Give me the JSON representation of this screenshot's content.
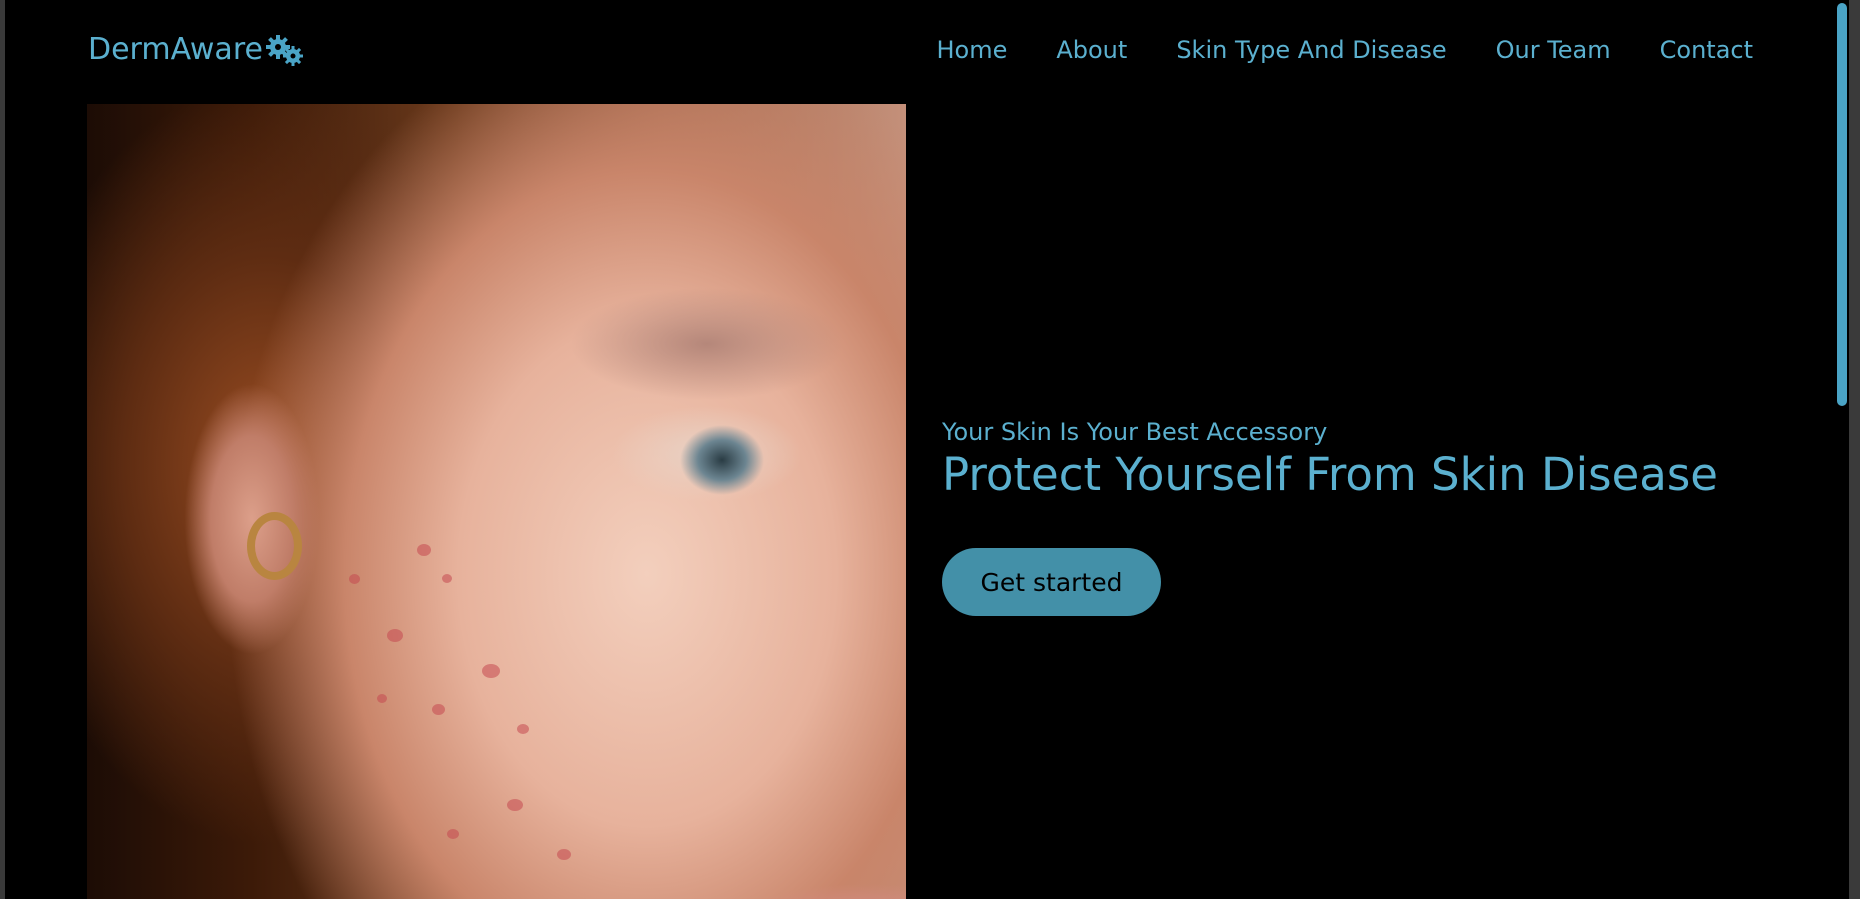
{
  "brand": {
    "name": "DermAware",
    "icon": "gears-icon",
    "color": "#5bb0cf"
  },
  "nav": {
    "items": [
      {
        "label": "Home"
      },
      {
        "label": "About"
      },
      {
        "label": "Skin Type And Disease"
      },
      {
        "label": "Our Team"
      },
      {
        "label": "Contact"
      }
    ]
  },
  "hero": {
    "tagline": "Your Skin Is Your Best Accessory",
    "headline": "Protect Yourself From Skin Disease",
    "cta_label": "Get started",
    "cta_color": "#4390a8"
  }
}
